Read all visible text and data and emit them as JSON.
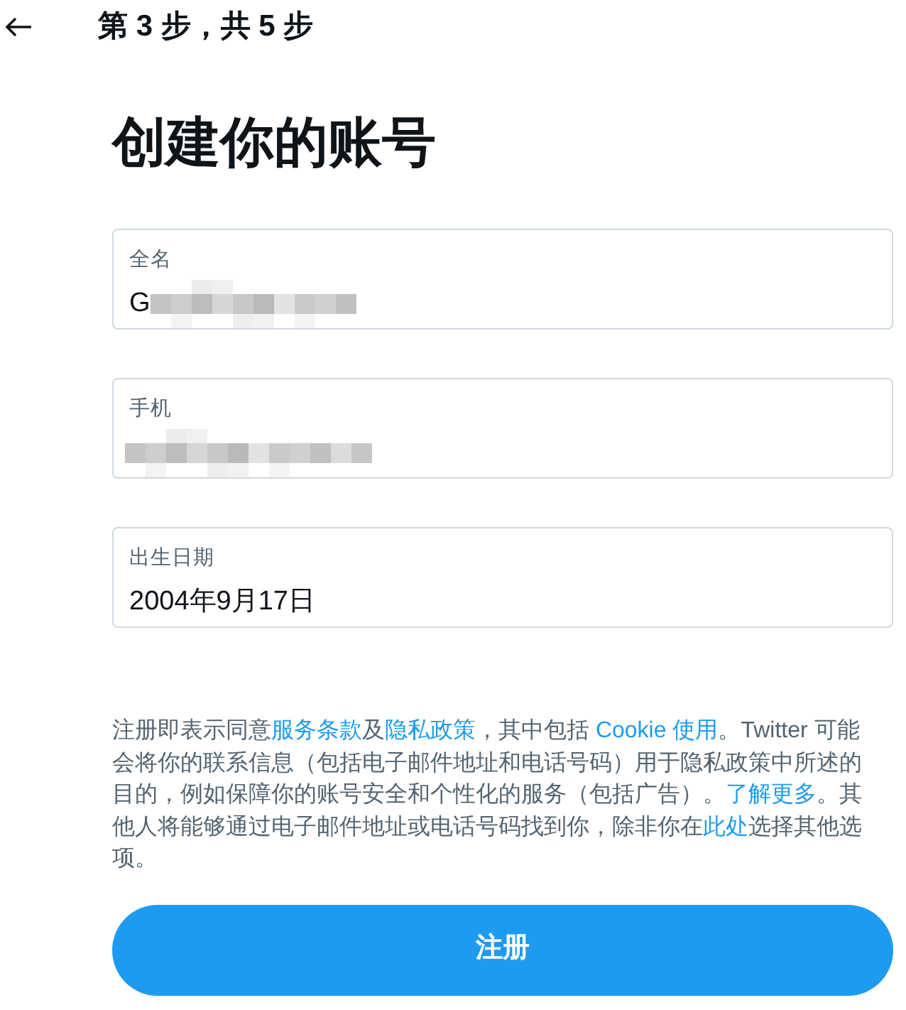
{
  "header": {
    "step": "第 3 步，共 5 步"
  },
  "title": "创建你的账号",
  "fields": [
    {
      "label": "全名",
      "value": "G",
      "redacted": true
    },
    {
      "label": "手机",
      "redacted": true
    },
    {
      "label": "出生日期",
      "value": "2004年9月17日",
      "redacted": false
    }
  ],
  "legal_text": [
    {
      "kind": "text",
      "text": "注册即表示同意"
    },
    {
      "kind": "link",
      "text": "服务条款"
    },
    {
      "kind": "text",
      "text": "及"
    },
    {
      "kind": "link",
      "text": "隐私政策"
    },
    {
      "kind": "text",
      "text": "，其中包括 "
    },
    {
      "kind": "link",
      "text": "Cookie 使用"
    },
    {
      "kind": "text",
      "text": "。Twitter 可能会将你的联系信息（包括电子邮件地址和电话号码）用于隐私政策中所述的目的，例如保障你的账号安全和个性化的服务（包括广告）。"
    },
    {
      "kind": "link",
      "text": "了解更多"
    },
    {
      "kind": "text",
      "text": "。其他人将能够通过电子邮件地址或电话号码找到你，除非你在"
    },
    {
      "kind": "link",
      "text": "此处"
    },
    {
      "kind": "text",
      "text": "选择其他选项。"
    }
  ],
  "submit_button": "注册"
}
